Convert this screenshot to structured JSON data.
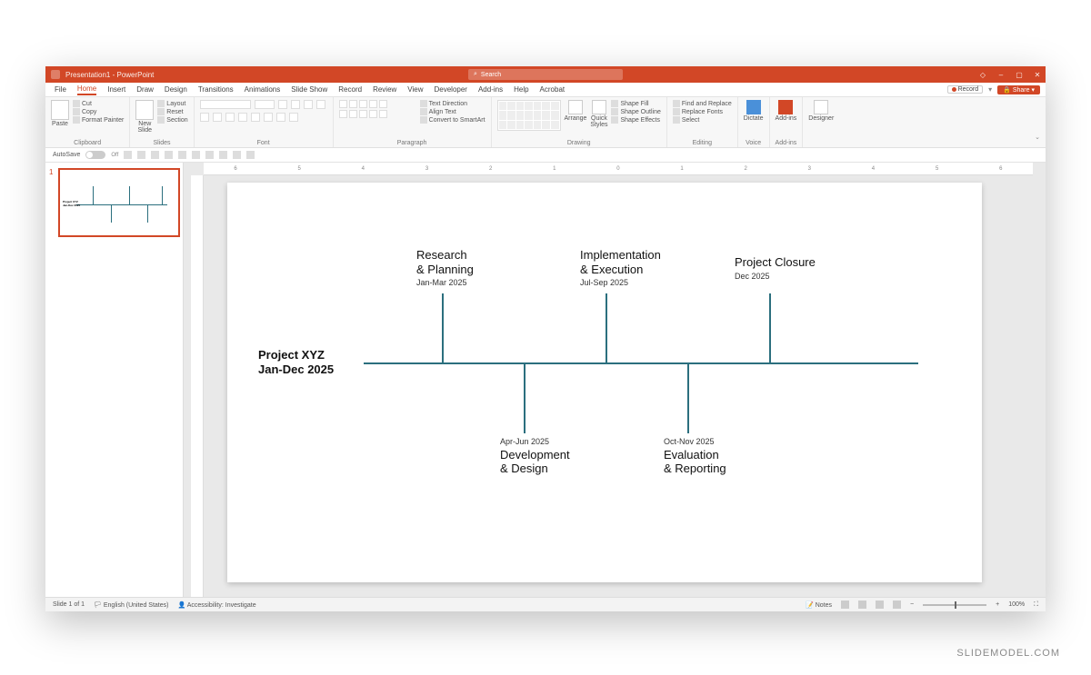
{
  "titlebar": {
    "title": "Presentation1 - PowerPoint",
    "search_placeholder": "Search"
  },
  "window_controls": {
    "min": "–",
    "max": "▢",
    "close": "✕",
    "user": "◇"
  },
  "tabs": {
    "file": "File",
    "home": "Home",
    "insert": "Insert",
    "draw": "Draw",
    "design": "Design",
    "transitions": "Transitions",
    "animations": "Animations",
    "slideshow": "Slide Show",
    "record": "Record",
    "review": "Review",
    "view": "View",
    "developer": "Developer",
    "addins": "Add-ins",
    "help": "Help",
    "acrobat": "Acrobat"
  },
  "topright": {
    "record": "Record",
    "share": "Share"
  },
  "ribbon": {
    "clipboard": {
      "label": "Clipboard",
      "paste": "Paste",
      "cut": "Cut",
      "copy": "Copy",
      "format_painter": "Format Painter"
    },
    "slides": {
      "label": "Slides",
      "new_slide": "New\nSlide",
      "layout": "Layout",
      "reset": "Reset",
      "section": "Section"
    },
    "font": {
      "label": "Font"
    },
    "paragraph": {
      "label": "Paragraph",
      "text_direction": "Text Direction",
      "align_text": "Align Text",
      "convert_smartart": "Convert to SmartArt"
    },
    "drawing": {
      "label": "Drawing",
      "arrange": "Arrange",
      "quick_styles": "Quick\nStyles",
      "shape_fill": "Shape Fill",
      "shape_outline": "Shape Outline",
      "shape_effects": "Shape Effects"
    },
    "editing": {
      "label": "Editing",
      "find": "Find and Replace",
      "replace": "Replace Fonts",
      "select": "Select"
    },
    "voice": {
      "label": "Voice",
      "dictate": "Dictate"
    },
    "addins": {
      "label": "Add-ins",
      "addins_btn": "Add-ins"
    },
    "designer": {
      "label": "",
      "designer": "Designer"
    }
  },
  "qat": {
    "autosave": "AutoSave",
    "autosave_state": "Off"
  },
  "ruler_marks": [
    "6",
    "5",
    "4",
    "3",
    "2",
    "1",
    "0",
    "1",
    "2",
    "3",
    "4",
    "5",
    "6"
  ],
  "thumbnail": {
    "number": "1"
  },
  "slide": {
    "title_line1": "Project XYZ",
    "title_line2": "Jan-Dec 2025",
    "items": [
      {
        "head": "Research\n& Planning",
        "date": "Jan-Mar 2025",
        "pos": "top"
      },
      {
        "head": "Development\n& Design",
        "date": "Apr-Jun 2025",
        "pos": "bottom"
      },
      {
        "head": "Implementation\n& Execution",
        "date": "Jul-Sep 2025",
        "pos": "top"
      },
      {
        "head": "Evaluation\n& Reporting",
        "date": "Oct-Nov 2025",
        "pos": "bottom"
      },
      {
        "head": "Project Closure",
        "date": "Dec 2025",
        "pos": "top"
      }
    ]
  },
  "statusbar": {
    "slide_info": "Slide 1 of 1",
    "language": "English (United States)",
    "accessibility": "Accessibility: Investigate",
    "notes": "Notes",
    "zoom": "100%"
  },
  "watermark": "SLIDEMODEL.COM"
}
